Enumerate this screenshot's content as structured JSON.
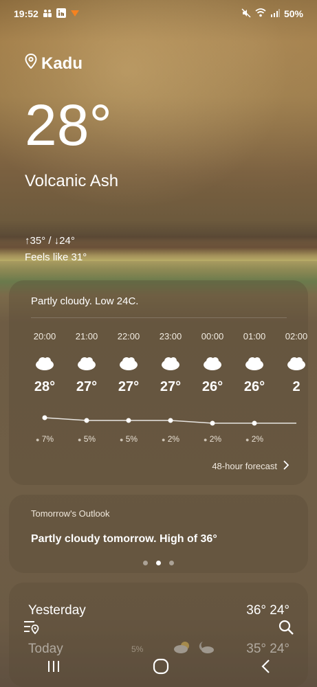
{
  "status": {
    "time": "19:52",
    "battery": "50%",
    "icons_left": [
      "teams-icon",
      "linkedin-icon",
      "notification-icon"
    ],
    "icons_right": [
      "mute-icon",
      "wifi-icon",
      "signal-icon"
    ]
  },
  "location": {
    "name": "Kadu"
  },
  "current": {
    "temperature": "28°",
    "condition": "Volcanic Ash",
    "high_low": "↑35° / ↓24°",
    "feels_like": "Feels like 31°"
  },
  "hourly_card": {
    "summary": "Partly cloudy. Low 24C.",
    "forecast_link": "48-hour forecast",
    "hours": [
      {
        "time": "20:00",
        "temp": "28°",
        "precip": "7%",
        "temp_value": 28
      },
      {
        "time": "21:00",
        "temp": "27°",
        "precip": "5%",
        "temp_value": 27
      },
      {
        "time": "22:00",
        "temp": "27°",
        "precip": "5%",
        "temp_value": 27
      },
      {
        "time": "23:00",
        "temp": "27°",
        "precip": "2%",
        "temp_value": 27
      },
      {
        "time": "00:00",
        "temp": "26°",
        "precip": "2%",
        "temp_value": 26
      },
      {
        "time": "01:00",
        "temp": "26°",
        "precip": "2%",
        "temp_value": 26
      },
      {
        "time": "02:00",
        "temp": "2",
        "precip": "",
        "temp_value": 26
      }
    ]
  },
  "outlook_card": {
    "title": "Tomorrow's Outlook",
    "text": "Partly cloudy tomorrow. High of 36°",
    "page_count": 3,
    "active_page": 1
  },
  "daily_card": {
    "days": [
      {
        "name": "Yesterday",
        "temps": "36° 24°",
        "precip": ""
      },
      {
        "name": "Today",
        "temps": "35° 24°",
        "precip": "5%"
      }
    ]
  },
  "colors": {
    "text": "#ffffff",
    "card_bg": "rgba(90,75,55,0.35)"
  }
}
